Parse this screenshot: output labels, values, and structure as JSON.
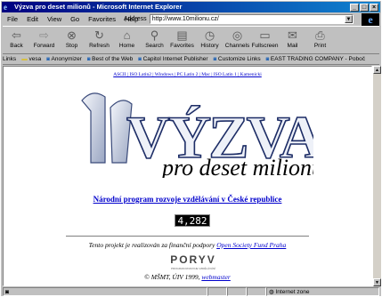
{
  "window": {
    "title": "Výzva pro deset milionů - Microsoft Internet Explorer"
  },
  "menu": [
    "File",
    "Edit",
    "View",
    "Go",
    "Favorites",
    "Help"
  ],
  "toolbar": [
    {
      "label": "Back",
      "icon": "back-arrow-icon"
    },
    {
      "label": "Forward",
      "icon": "forward-arrow-icon"
    },
    {
      "label": "Stop",
      "icon": "stop-icon"
    },
    {
      "label": "Refresh",
      "icon": "refresh-icon"
    },
    {
      "label": "Home",
      "icon": "home-icon"
    },
    {
      "label": "Search",
      "icon": "search-icon"
    },
    {
      "label": "Favorites",
      "icon": "favorites-icon"
    },
    {
      "label": "History",
      "icon": "history-icon"
    },
    {
      "label": "Channels",
      "icon": "channels-icon"
    },
    {
      "label": "Fullscreen",
      "icon": "fullscreen-icon"
    },
    {
      "label": "Mail",
      "icon": "mail-icon"
    },
    {
      "label": "Print",
      "icon": "print-icon"
    }
  ],
  "address": {
    "label": "Address",
    "url": "http://www.10milionu.cz/"
  },
  "links": {
    "label": "Links",
    "items": [
      "vesa",
      "Anonymizer",
      "Best of the Web",
      "Capitol Internet Publisher",
      "Customize Links",
      "EAST TRADING COMPANY - Poboč"
    ]
  },
  "page": {
    "encodings": "ASCII | ISO Latin2 | Windows | PC Latin 2 | Mac | ISO Latin 1 | Kamenicki",
    "logo_word": "VÝZVA",
    "logo_prefix": "10",
    "logo_tagline": "pro deset milionů",
    "subtitle": "Národní program rozvoje vzdělávání v České republice",
    "counter": "4,282",
    "support_text": "Tento projekt je realizován za finanční podpory ",
    "support_link": "Open Society Fund Praha",
    "poryv": "PORYV",
    "poryv_small": "PROGRAM ROZVOJE VZDĚLÁVÁNÍ",
    "copyright": "© MŠMT, ÚIV 1999, ",
    "webmaster": "webmaster"
  },
  "status": {
    "icon": "ie-page-icon",
    "zone": "Internet zone"
  }
}
